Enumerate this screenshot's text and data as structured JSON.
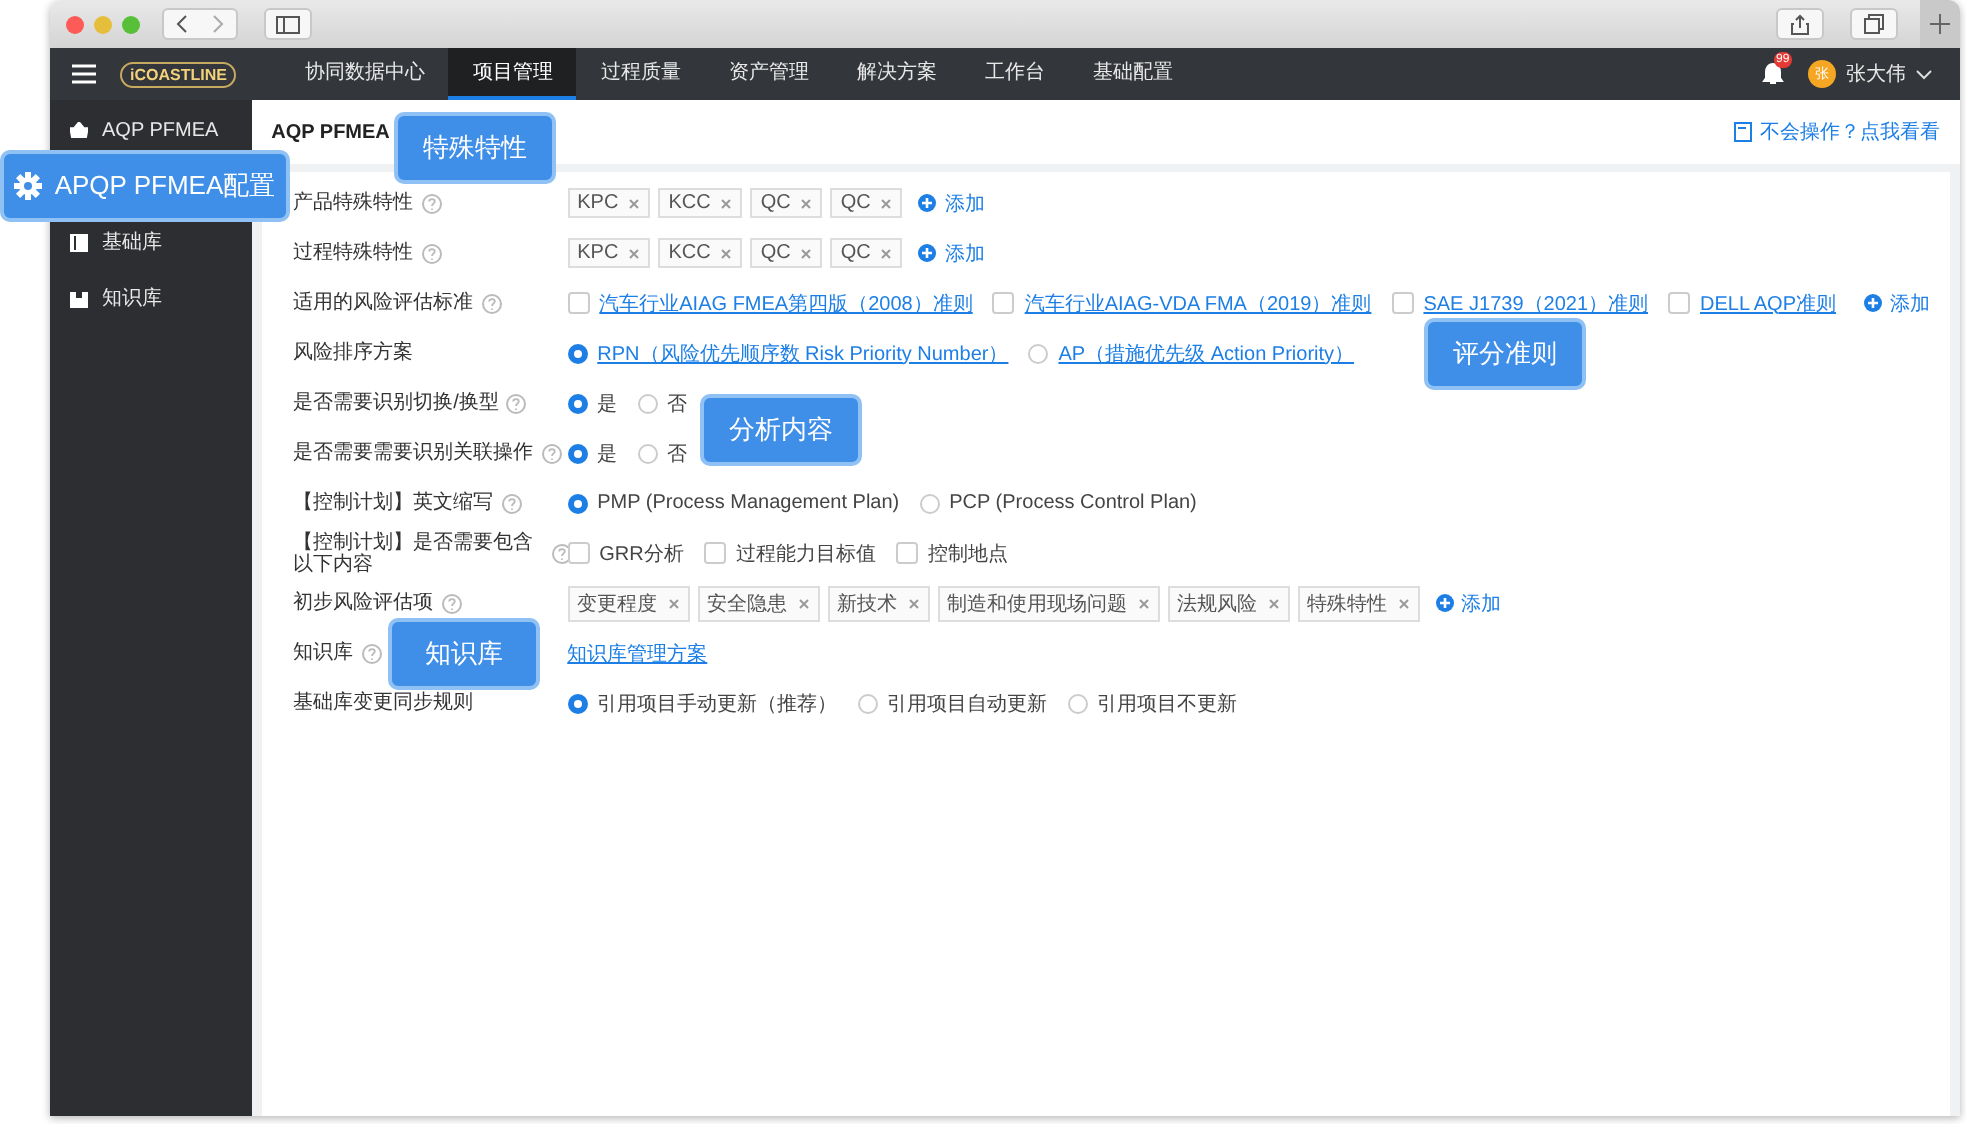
{
  "nav": {
    "items": [
      {
        "label": "协同数据中心",
        "selected": false
      },
      {
        "label": "项目管理",
        "selected": true
      },
      {
        "label": "过程质量",
        "selected": false
      },
      {
        "label": "资产管理",
        "selected": false
      },
      {
        "label": "解决方案",
        "selected": false
      },
      {
        "label": "工作台",
        "selected": false
      },
      {
        "label": "基础配置",
        "selected": false
      }
    ],
    "logo": "iCOASTLINE",
    "notification_count": "99",
    "user": {
      "avatar": "张",
      "name": "张大伟"
    }
  },
  "sidebar": {
    "items": [
      {
        "label": "AQP PFMEA",
        "kind": "basket"
      },
      {
        "label": "基础库",
        "kind": "book"
      },
      {
        "label": "知识库",
        "kind": "note"
      }
    ]
  },
  "page": {
    "title": "AQP PFMEA",
    "help_link": "不会操作？点我看看"
  },
  "form": {
    "rows": [
      {
        "label": "产品特殊特性",
        "help": true,
        "kind": "tags",
        "tags": [
          "KPC",
          "KCC",
          "QC",
          "QC"
        ],
        "add": "添加"
      },
      {
        "label": "过程特殊特性",
        "help": true,
        "kind": "tags",
        "tags": [
          "KPC",
          "KCC",
          "QC",
          "QC"
        ],
        "add": "添加"
      },
      {
        "label": "适用的风险评估标准",
        "help": true,
        "kind": "checks",
        "options": [
          {
            "label": "汽车行业AIAG FMEA第四版（2008）准则",
            "checked": false,
            "link": true
          },
          {
            "label": "汽车行业AIAG-VDA FMA（2019）准则",
            "checked": false,
            "link": true
          },
          {
            "label": "SAE J1739（2021）准则",
            "checked": false,
            "link": true
          },
          {
            "label": "DELL AQP准则",
            "checked": false,
            "link": true
          }
        ],
        "add": "添加"
      },
      {
        "label": "风险排序方案",
        "help": false,
        "kind": "radios",
        "options": [
          {
            "label": "RPN（风险优先顺序数 Risk Priority Number）",
            "selected": true,
            "link": true
          },
          {
            "label": "AP（措施优先级 Action Priority）",
            "selected": false,
            "link": true
          }
        ]
      },
      {
        "label": "是否需要识别切换/换型",
        "help": true,
        "kind": "radios",
        "options": [
          {
            "label": "是",
            "selected": true,
            "link": false
          },
          {
            "label": "否",
            "selected": false,
            "link": false
          }
        ]
      },
      {
        "label": "是否需要需要识别关联操作",
        "help": true,
        "kind": "radios",
        "options": [
          {
            "label": "是",
            "selected": true,
            "link": false
          },
          {
            "label": "否",
            "selected": false,
            "link": false
          }
        ]
      },
      {
        "label": "【控制计划】英文缩写",
        "help": true,
        "kind": "radios",
        "options": [
          {
            "label": "PMP (Process Management Plan)",
            "selected": true,
            "link": false
          },
          {
            "label": "PCP (Process Control Plan)",
            "selected": false,
            "link": false
          }
        ]
      },
      {
        "label": "【控制计划】是否需要包含以下内容",
        "help": true,
        "kind": "checks",
        "options": [
          {
            "label": "GRR分析",
            "checked": false,
            "link": false
          },
          {
            "label": "过程能力目标值",
            "checked": false,
            "link": false
          },
          {
            "label": "控制地点",
            "checked": false,
            "link": false
          }
        ]
      },
      {
        "label": "初步风险评估项",
        "help": true,
        "kind": "tags",
        "tags": [
          "变更程度",
          "安全隐患",
          "新技术",
          "制造和使用现场问题",
          "法规风险",
          "特殊特性"
        ],
        "add": "添加"
      },
      {
        "label": "知识库",
        "help": true,
        "kind": "link",
        "link": "知识库管理方案"
      },
      {
        "label": "基础库变更同步规则",
        "help": false,
        "kind": "radios",
        "options": [
          {
            "label": "引用项目手动更新（推荐）",
            "selected": true,
            "link": false
          },
          {
            "label": "引用项目自动更新",
            "selected": false,
            "link": false
          },
          {
            "label": "引用项目不更新",
            "selected": false,
            "link": false
          }
        ]
      }
    ]
  },
  "callouts": [
    {
      "text": "APQP PFMEA配置",
      "kind": "gear"
    },
    {
      "text": "特殊特性",
      "kind": "plain"
    },
    {
      "text": "评分准则",
      "kind": "plain"
    },
    {
      "text": "分析内容",
      "kind": "plain"
    },
    {
      "text": "知识库",
      "kind": "plain"
    }
  ]
}
